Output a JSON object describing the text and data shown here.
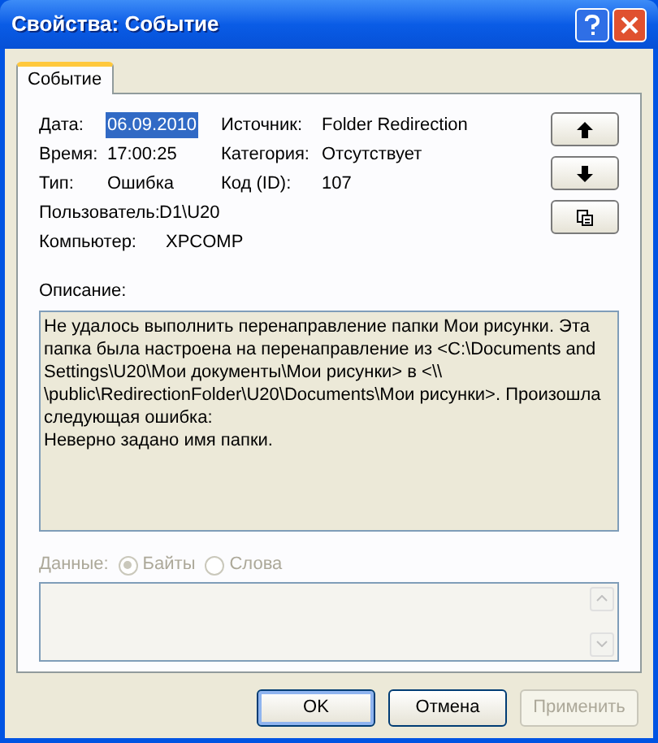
{
  "window": {
    "title": "Свойства: Событие"
  },
  "tabs": [
    {
      "label": "Событие",
      "selected": true
    }
  ],
  "fields_left": [
    {
      "label": "Дата:",
      "value": "06.09.2010",
      "selected": true
    },
    {
      "label": "Время:",
      "value": "17:00:25",
      "selected": false
    },
    {
      "label": "Тип:",
      "value": "Ошибка",
      "selected": false
    }
  ],
  "fields_right": [
    {
      "label": "Источник:",
      "value": "Folder Redirection"
    },
    {
      "label": "Категория:",
      "value": "Отсутствует"
    },
    {
      "label": "Код (ID):",
      "value": "107"
    }
  ],
  "user": {
    "label": "Пользователь:",
    "value": "D1\\U20"
  },
  "computer": {
    "label": "Компьютер:",
    "value": "XPCOMP"
  },
  "side_buttons": [
    {
      "kind": "up"
    },
    {
      "kind": "down"
    },
    {
      "kind": "copy"
    }
  ],
  "description": {
    "label": "Описание:",
    "lines": [
      "Не удалось выполнить перенаправление папки Мои рисунки. Эта папка была настроена на перенаправление из <C:\\Documents and Settings\\U20\\Мои документы\\Мои рисунки> в <\\\\",
      "\\public\\RedirectionFolder\\U20\\Documents\\Мои рисунки>. Произошла следующая ошибка:",
      "Неверно задано имя папки."
    ]
  },
  "data": {
    "label": "Данные:",
    "disabled": true,
    "options": [
      {
        "label": "Байты",
        "checked": true
      },
      {
        "label": "Слова",
        "checked": false
      }
    ]
  },
  "buttons": [
    {
      "label": "OK",
      "default": true,
      "disabled": false
    },
    {
      "label": "Отмена",
      "default": false,
      "disabled": false
    },
    {
      "label": "Применить",
      "default": false,
      "disabled": true
    }
  ]
}
